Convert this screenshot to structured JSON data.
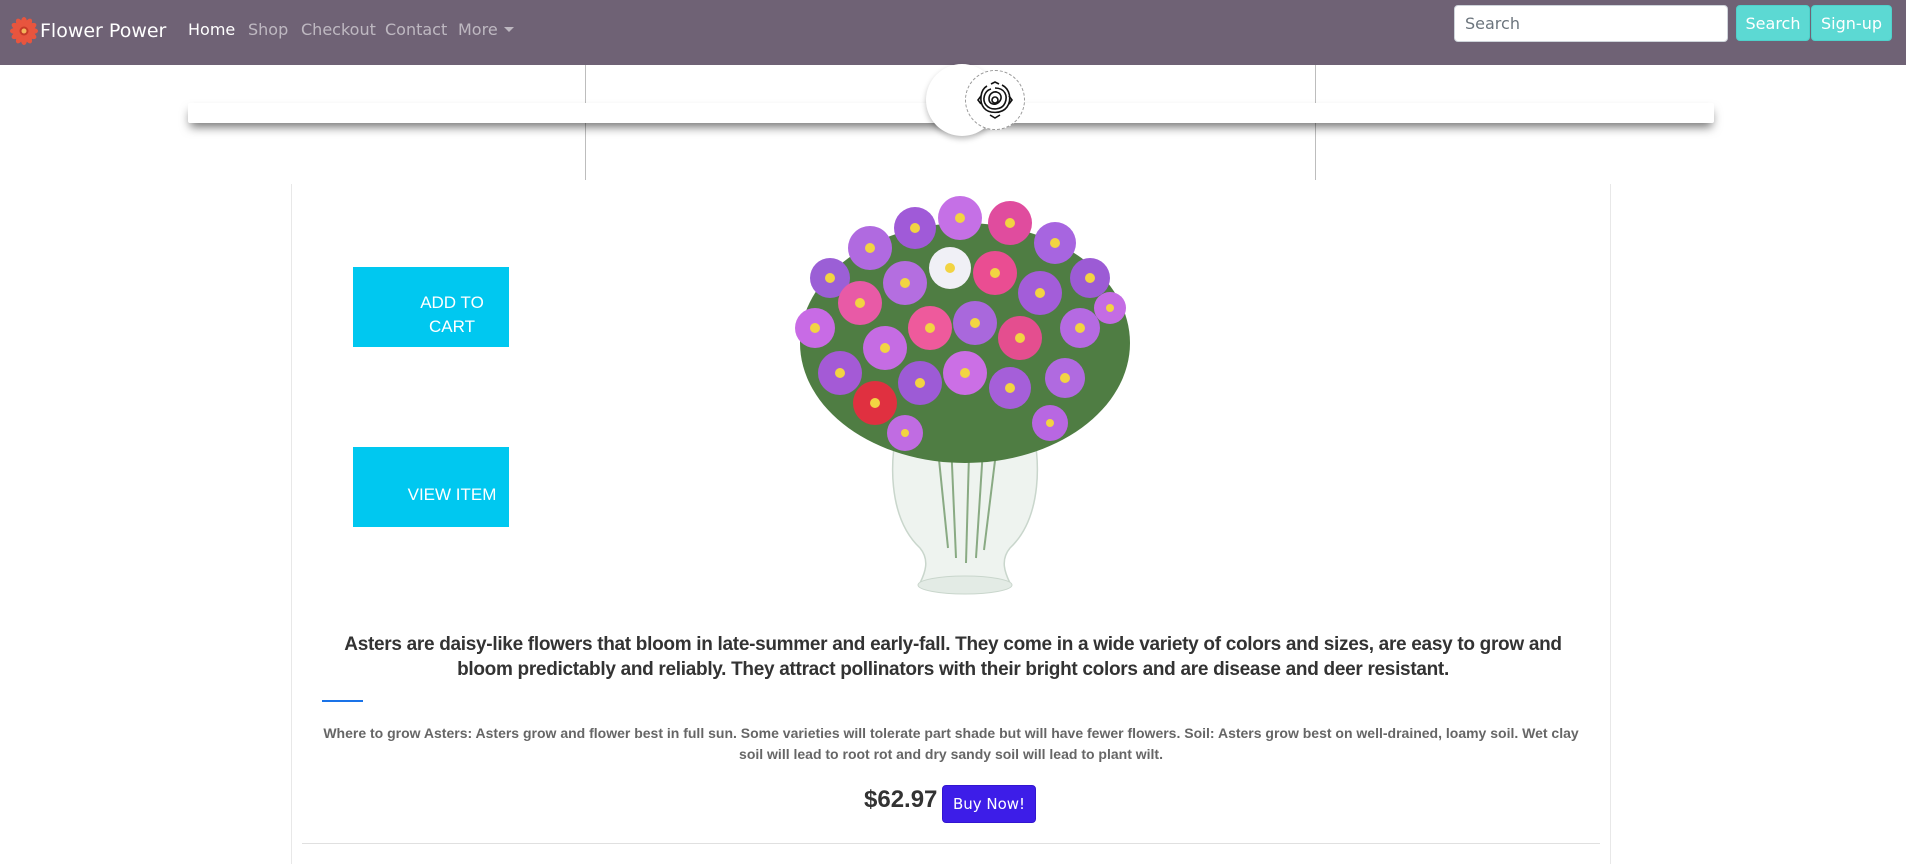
{
  "navbar": {
    "brand": "Flower Power",
    "links": [
      "Home",
      "Shop",
      "Checkout",
      "Contact",
      "More"
    ],
    "search_placeholder": "Search",
    "search_button": "Search",
    "signup_button": "Sign-up",
    "colors": {
      "background": "#6f6275",
      "accent": "#5cd9d3"
    }
  },
  "product": {
    "add_to_cart": "ADD TO CART",
    "view_item": "VIEW ITEM",
    "description": "Asters are daisy-like flowers that bloom in late-summer and early-fall. They come in a wide variety of colors and sizes, are easy to grow and bloom predictably and reliably. They attract pollinators with their bright colors and are disease and deer resistant.",
    "growing_info": "Where to grow Asters: Asters grow and flower best in full sun. Some varieties will tolerate part shade but will have fewer flowers. Soil: Asters grow best on well-drained, loamy soil. Wet clay soil will lead to root rot and dry sandy soil will lead to plant wilt.",
    "price": "$62.97",
    "buy_button": "Buy Now!",
    "colors": {
      "action": "#00c8f0",
      "buy": "#3d1de8"
    }
  }
}
